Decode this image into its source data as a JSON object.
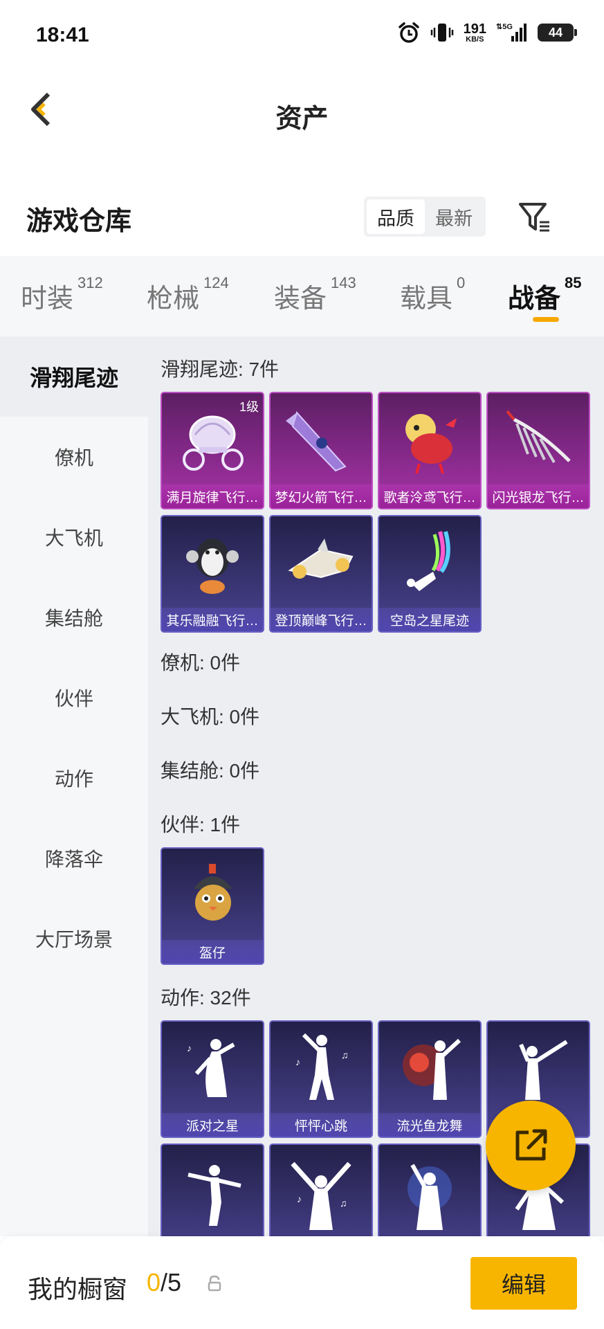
{
  "status_bar": {
    "time": "18:41",
    "net_speed": "191",
    "net_unit": "KB/S",
    "signal_label": "5G",
    "battery": "44"
  },
  "header": {
    "title": "资产"
  },
  "warehouse": {
    "title": "游戏仓库",
    "sort_options": [
      "品质",
      "最新"
    ],
    "active_sort": "品质"
  },
  "tabs": [
    {
      "label": "时装",
      "count": "312"
    },
    {
      "label": "枪械",
      "count": "124"
    },
    {
      "label": "装备",
      "count": "143"
    },
    {
      "label": "载具",
      "count": "0"
    },
    {
      "label": "战备",
      "count": "85"
    }
  ],
  "active_tab": "战备",
  "sidebar": {
    "items": [
      "滑翔尾迹",
      "僚机",
      "大飞机",
      "集结舱",
      "伙伴",
      "动作",
      "降落伞",
      "大厅场景"
    ],
    "active": "滑翔尾迹"
  },
  "sections": {
    "glide": {
      "title": "滑翔尾迹: 7件",
      "items": [
        {
          "name": "满月旋律飞行…",
          "level": "1级",
          "rarity": "purple",
          "icon": "carriage-icon"
        },
        {
          "name": "梦幻火箭飞行…",
          "rarity": "purple",
          "icon": "rocket-glider-icon"
        },
        {
          "name": "歌者泠鸢飞行…",
          "rarity": "purple",
          "icon": "red-bird-icon"
        },
        {
          "name": "闪光银龙飞行…",
          "rarity": "purple",
          "icon": "silver-wing-icon"
        },
        {
          "name": "其乐融融飞行…",
          "rarity": "blue",
          "icon": "penguin-icon"
        },
        {
          "name": "登顶巅峰飞行…",
          "rarity": "blue",
          "icon": "jet-glider-icon"
        },
        {
          "name": "空岛之星尾迹",
          "rarity": "blue",
          "icon": "rainbow-trail-icon"
        }
      ]
    },
    "wingman": {
      "title": "僚机: 0件"
    },
    "plane": {
      "title": "大飞机: 0件"
    },
    "pod": {
      "title": "集结舱: 0件"
    },
    "partner": {
      "title": "伙伴: 1件",
      "items": [
        {
          "name": "盔仔",
          "rarity": "blue",
          "icon": "helmet-chick-icon"
        }
      ]
    },
    "emote": {
      "title": "动作: 32件",
      "items": [
        {
          "name": "派对之星",
          "rarity": "blue",
          "icon": "dance-pose-icon"
        },
        {
          "name": "怦怦心跳",
          "rarity": "blue",
          "icon": "dance-pose-icon"
        },
        {
          "name": "流光鱼龙舞",
          "rarity": "blue",
          "icon": "dragon-dance-icon"
        },
        {
          "name": "",
          "rarity": "blue",
          "icon": "dance-pose-icon"
        },
        {
          "name": "",
          "rarity": "blue",
          "icon": "dance-pose-icon"
        },
        {
          "name": "",
          "rarity": "blue",
          "icon": "dance-pose-icon"
        },
        {
          "name": "",
          "rarity": "blue",
          "icon": "dance-pose-icon"
        },
        {
          "name": "",
          "rarity": "blue",
          "icon": "dance-pose-icon"
        }
      ]
    }
  },
  "bottom": {
    "label": "我的橱窗",
    "current": "0",
    "total": "/5",
    "edit_label": "编辑"
  },
  "colors": {
    "accent": "#f7b500",
    "purple_card": "#8a2a8e",
    "blue_card": "#3a3573"
  }
}
